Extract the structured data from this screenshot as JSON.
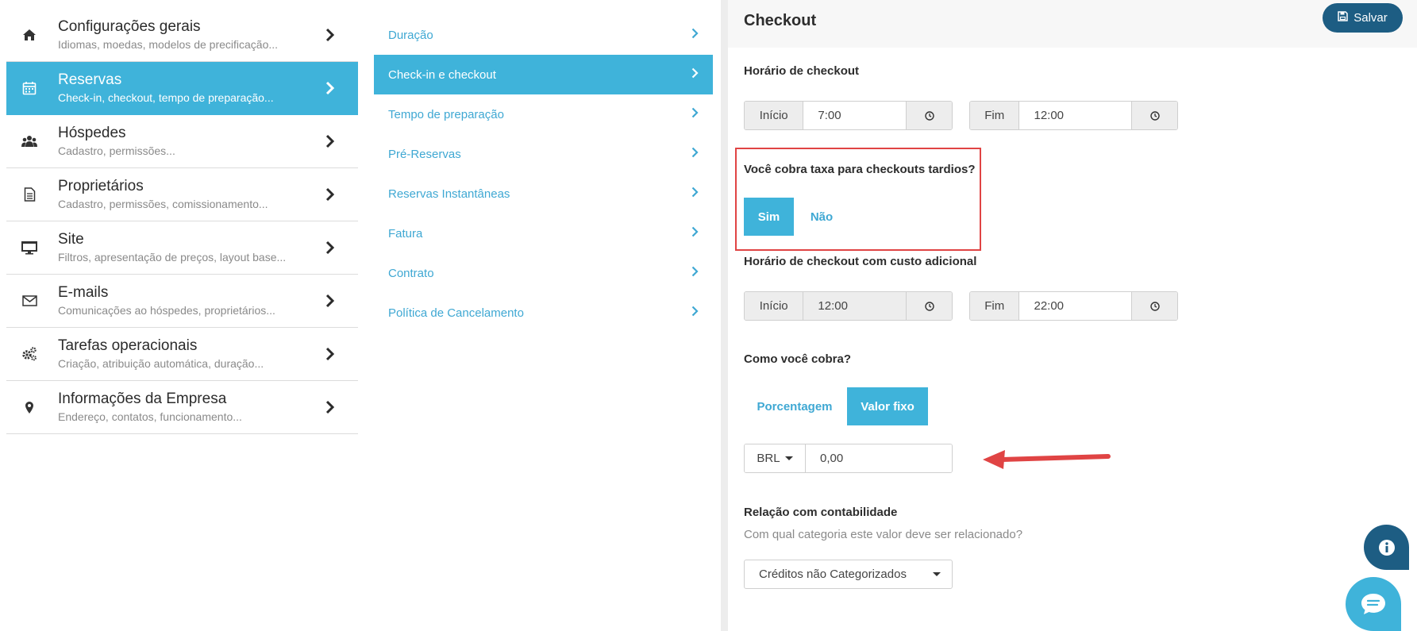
{
  "sidebar": {
    "items": [
      {
        "title": "Configurações gerais",
        "subtitle": "Idiomas, moedas, modelos de precificação...",
        "icon": "home-icon"
      },
      {
        "title": "Reservas",
        "subtitle": "Check-in, checkout, tempo de preparação...",
        "icon": "calendar-icon"
      },
      {
        "title": "Hóspedes",
        "subtitle": "Cadastro, permissões...",
        "icon": "users-icon"
      },
      {
        "title": "Proprietários",
        "subtitle": "Cadastro, permissões, comissionamento...",
        "icon": "document-icon"
      },
      {
        "title": "Site",
        "subtitle": "Filtros, apresentação de preços, layout base...",
        "icon": "monitor-icon"
      },
      {
        "title": "E-mails",
        "subtitle": "Comunicações ao hóspedes, proprietários...",
        "icon": "envelope-icon"
      },
      {
        "title": "Tarefas operacionais",
        "subtitle": "Criação, atribuição automática, duração...",
        "icon": "gears-icon"
      },
      {
        "title": "Informações da Empresa",
        "subtitle": "Endereço, contatos, funcionamento...",
        "icon": "map-pin-icon"
      }
    ]
  },
  "subnav": {
    "items": [
      "Duração",
      "Check-in e checkout",
      "Tempo de preparação",
      "Pré-Reservas",
      "Reservas Instantâneas",
      "Fatura",
      "Contrato",
      "Política de Cancelamento"
    ]
  },
  "panel": {
    "title": "Checkout",
    "save_label": "Salvar",
    "checkout_time": {
      "label": "Horário de checkout",
      "start_label": "Início",
      "start_value": "7:00",
      "end_label": "Fim",
      "end_value": "12:00"
    },
    "late_fee": {
      "question": "Você cobra taxa para checkouts tardios?",
      "yes": "Sim",
      "no": "Não"
    },
    "extra_time": {
      "label": "Horário de checkout com custo adicional",
      "start_label": "Início",
      "start_value": "12:00",
      "end_label": "Fim",
      "end_value": "22:00"
    },
    "charge": {
      "question": "Como você cobra?",
      "percent": "Porcentagem",
      "fixed": "Valor fixo",
      "currency": "BRL",
      "amount": "0,00"
    },
    "accounting": {
      "label": "Relação com contabilidade",
      "hint": "Com qual categoria este valor deve ser relacionado?",
      "selected": "Créditos não Categorizados"
    }
  },
  "colors": {
    "accent": "#3fb3da",
    "primary_dark": "#1d5d83",
    "highlight": "#e04444"
  }
}
